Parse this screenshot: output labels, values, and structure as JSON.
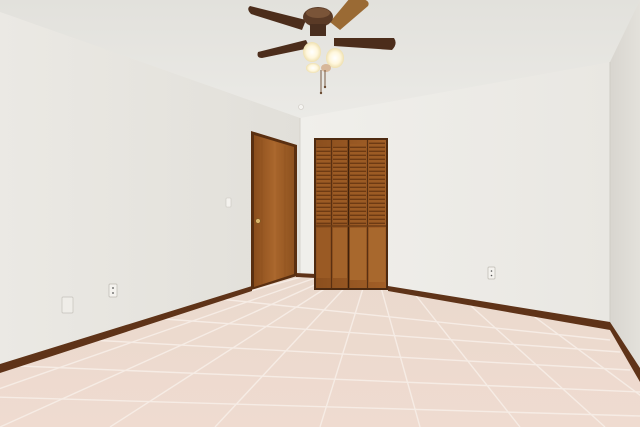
{
  "scene": {
    "kind": "empty-bedroom-photo",
    "elements": [
      "ceiling-fan",
      "entry-door",
      "louvered-closet-door",
      "tile-floor",
      "wood-baseboard",
      "light-switch",
      "wall-outlet"
    ]
  },
  "colors": {
    "ceiling": "#e7e6e1",
    "left_wall": "#e8e6e1",
    "back_wall": "#eeede9",
    "right_wall": "#dcdad4",
    "floor": "#ead7cb",
    "grout": "#f3e8e0",
    "wood": "#9a5a22",
    "wood_dark": "#6b3a14",
    "baseboard": "#5f3318",
    "fan_bronze": "#5a3a26",
    "fan_light": "#fffbe8"
  }
}
